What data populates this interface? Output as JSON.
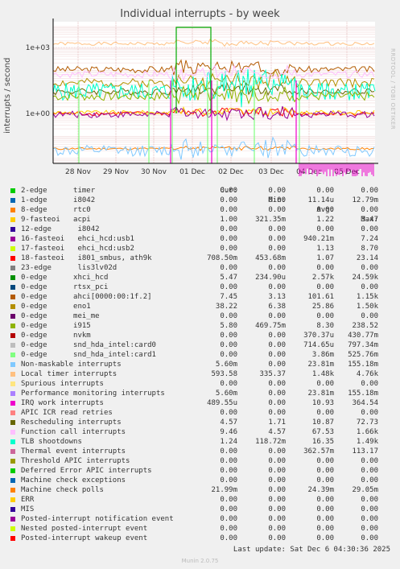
{
  "chart_data": {
    "type": "line",
    "title": "Individual interrupts - by week",
    "ylabel": "interrupts / second",
    "yscale": "log",
    "ylim": [
      3e-05,
      30
    ],
    "yticks": [
      "1e+03",
      "1e+00",
      "1e-03"
    ],
    "xticks": [
      "28 Nov",
      "29 Nov",
      "30 Nov",
      "01 Dec",
      "02 Dec",
      "03 Dec",
      "04 Dec",
      "05 Dec"
    ],
    "side_text": "RRDTOOL / TOBI OETIKER",
    "columns": [
      "Cur:",
      "Min:",
      "Avg:",
      "Max:"
    ],
    "series": [
      {
        "name": "2-edge      timer",
        "color": "#00cc00",
        "cur": "0.00",
        "min": "0.00",
        "avg": "0.00",
        "max": "0.00"
      },
      {
        "name": "1-edge      i8042",
        "color": "#0066b3",
        "cur": "0.00",
        "min": "0.00",
        "avg": "11.14u",
        "max": "12.79m"
      },
      {
        "name": "8-edge      rtc0",
        "color": "#ff8000",
        "cur": "0.00",
        "min": "0.00",
        "avg": "0.00",
        "max": "0.00"
      },
      {
        "name": "9-fasteoi   acpi",
        "color": "#ffcc00",
        "cur": "1.00",
        "min": "321.35m",
        "avg": "1.22",
        "max": "3.47"
      },
      {
        "name": "12-edge      i8042",
        "color": "#330099",
        "cur": "0.00",
        "min": "0.00",
        "avg": "0.00",
        "max": "0.00"
      },
      {
        "name": "16-fasteoi   ehci_hcd:usb1",
        "color": "#990099",
        "cur": "0.00",
        "min": "0.00",
        "avg": "940.21m",
        "max": "7.24"
      },
      {
        "name": "17-fasteoi   ehci_hcd:usb2",
        "color": "#ccff00",
        "cur": "0.00",
        "min": "0.00",
        "avg": "1.13",
        "max": "8.70"
      },
      {
        "name": "18-fasteoi   i801_smbus, ath9k",
        "color": "#ff0000",
        "cur": "708.50m",
        "min": "453.68m",
        "avg": "1.07",
        "max": "23.14"
      },
      {
        "name": "23-edge      lis3lv02d",
        "color": "#808080",
        "cur": "0.00",
        "min": "0.00",
        "avg": "0.00",
        "max": "0.00"
      },
      {
        "name": "0-edge      xhci_hcd",
        "color": "#008f00",
        "cur": "5.47",
        "min": "234.90u",
        "avg": "2.57k",
        "max": "24.59k"
      },
      {
        "name": "0-edge      rtsx_pci",
        "color": "#00487d",
        "cur": "0.00",
        "min": "0.00",
        "avg": "0.00",
        "max": "0.00"
      },
      {
        "name": "0-edge      ahci[0000:00:1f.2]",
        "color": "#b35a00",
        "cur": "7.45",
        "min": "3.13",
        "avg": "101.61",
        "max": "1.15k"
      },
      {
        "name": "0-edge      eno1",
        "color": "#b38f00",
        "cur": "38.22",
        "min": "6.38",
        "avg": "25.86",
        "max": "1.50k"
      },
      {
        "name": "0-edge      mei_me",
        "color": "#6b006b",
        "cur": "0.00",
        "min": "0.00",
        "avg": "0.00",
        "max": "0.00"
      },
      {
        "name": "0-edge      i915",
        "color": "#8fb300",
        "cur": "5.80",
        "min": "469.75m",
        "avg": "8.30",
        "max": "238.52"
      },
      {
        "name": "0-edge      nvkm",
        "color": "#b30000",
        "cur": "0.00",
        "min": "0.00",
        "avg": "370.37u",
        "max": "430.77m"
      },
      {
        "name": "0-edge      snd_hda_intel:card0",
        "color": "#bebebe",
        "cur": "0.00",
        "min": "0.00",
        "avg": "714.65u",
        "max": "797.34m"
      },
      {
        "name": "0-edge      snd_hda_intel:card1",
        "color": "#80ff80",
        "cur": "0.00",
        "min": "0.00",
        "avg": "3.86m",
        "max": "525.76m"
      },
      {
        "name": "Non-maskable interrupts",
        "color": "#80c9ff",
        "cur": "5.60m",
        "min": "0.00",
        "avg": "23.81m",
        "max": "155.18m"
      },
      {
        "name": "Local timer interrupts",
        "color": "#ffc080",
        "cur": "593.58",
        "min": "335.37",
        "avg": "1.48k",
        "max": "4.76k"
      },
      {
        "name": "Spurious interrupts",
        "color": "#ffe680",
        "cur": "0.00",
        "min": "0.00",
        "avg": "0.00",
        "max": "0.00"
      },
      {
        "name": "Performance monitoring interrupts",
        "color": "#aa80ff",
        "cur": "5.60m",
        "min": "0.00",
        "avg": "23.81m",
        "max": "155.18m"
      },
      {
        "name": "IRQ work interrupts",
        "color": "#ee00cc",
        "cur": "489.55u",
        "min": "0.00",
        "avg": "10.93",
        "max": "364.54"
      },
      {
        "name": "APIC ICR read retries",
        "color": "#ff8080",
        "cur": "0.00",
        "min": "0.00",
        "avg": "0.00",
        "max": "0.00"
      },
      {
        "name": "Rescheduling interrupts",
        "color": "#666600",
        "cur": "4.57",
        "min": "1.71",
        "avg": "10.87",
        "max": "72.73"
      },
      {
        "name": "Function call interrupts",
        "color": "#ffbfff",
        "cur": "9.46",
        "min": "4.57",
        "avg": "67.53",
        "max": "1.66k"
      },
      {
        "name": "TLB shootdowns",
        "color": "#00ffcc",
        "cur": "1.24",
        "min": "118.72m",
        "avg": "16.35",
        "max": "1.49k"
      },
      {
        "name": "Thermal event interrupts",
        "color": "#cc6699",
        "cur": "0.00",
        "min": "0.00",
        "avg": "362.57m",
        "max": "113.17"
      },
      {
        "name": "Threshold APIC interrupts",
        "color": "#999900",
        "cur": "0.00",
        "min": "0.00",
        "avg": "0.00",
        "max": "0.00"
      },
      {
        "name": "Deferred Error APIC interrupts",
        "color": "#00cc00",
        "cur": "0.00",
        "min": "0.00",
        "avg": "0.00",
        "max": "0.00"
      },
      {
        "name": "Machine check exceptions",
        "color": "#0066b3",
        "cur": "0.00",
        "min": "0.00",
        "avg": "0.00",
        "max": "0.00"
      },
      {
        "name": "Machine check polls",
        "color": "#ff8000",
        "cur": "21.99m",
        "min": "0.00",
        "avg": "24.39m",
        "max": "29.05m"
      },
      {
        "name": "ERR",
        "color": "#ffcc00",
        "cur": "0.00",
        "min": "0.00",
        "avg": "0.00",
        "max": "0.00"
      },
      {
        "name": "MIS",
        "color": "#330099",
        "cur": "0.00",
        "min": "0.00",
        "avg": "0.00",
        "max": "0.00"
      },
      {
        "name": "Posted-interrupt notification event",
        "color": "#990099",
        "cur": "0.00",
        "min": "0.00",
        "avg": "0.00",
        "max": "0.00"
      },
      {
        "name": "Nested posted-interrupt event",
        "color": "#ccff00",
        "cur": "0.00",
        "min": "0.00",
        "avg": "0.00",
        "max": "0.00"
      },
      {
        "name": "Posted-interrupt wakeup event",
        "color": "#ff0000",
        "cur": "0.00",
        "min": "0.00",
        "avg": "0.00",
        "max": "0.00"
      }
    ],
    "last_update": "Last update: Sat Dec  6 04:30:36 2025",
    "footer": "Munin 2.0.75"
  }
}
